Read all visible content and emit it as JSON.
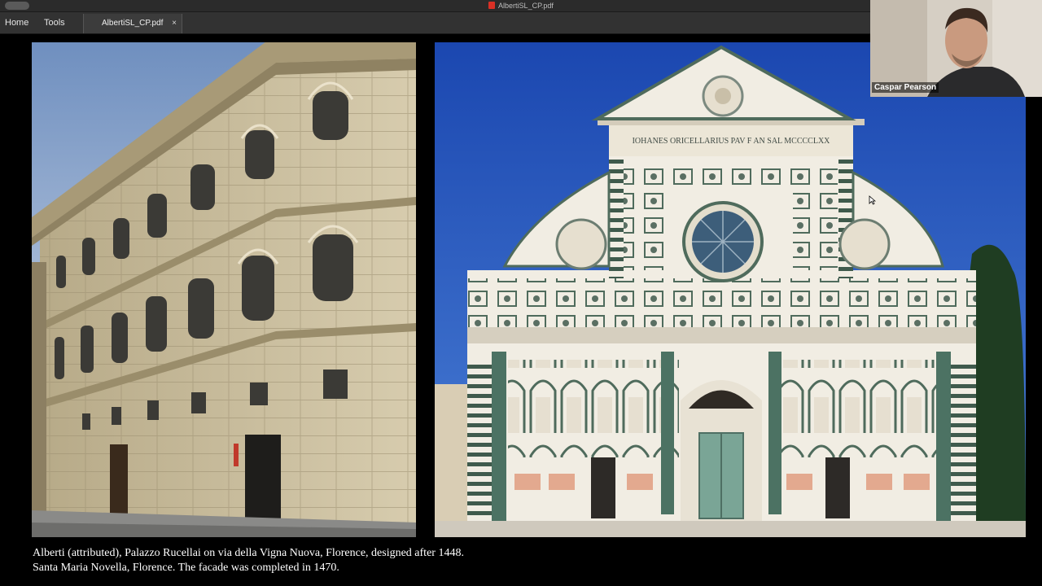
{
  "window": {
    "title": "AlbertiSL_CP.pdf"
  },
  "menu": {
    "home": "Home",
    "tools": "Tools"
  },
  "tab": {
    "label": "AlbertiSL_CP.pdf",
    "close": "×"
  },
  "caption": {
    "line1": "Alberti (attributed), Palazzo Rucellai on via della Vigna Nuova, Florence, designed after 1448.",
    "line2": "Santa Maria Novella, Florence. The facade was completed in 1470."
  },
  "facade_inscription": "IOHANES ORICELLARIUS PAV F AN SAL MCCCCLXX",
  "video": {
    "participant_name": "Caspar Pearson"
  },
  "icons": {
    "pdf": "pdf-file-icon",
    "close": "close-icon",
    "cursor": "pointer-cursor-icon"
  },
  "colors": {
    "background": "#000000",
    "titlebar": "#2b2b2b",
    "menubar": "#323232",
    "sky": "#1f4fb8",
    "stone": "#c9bd9e",
    "marble": "#f1ede3",
    "green_marble": "#3f6b5a"
  }
}
